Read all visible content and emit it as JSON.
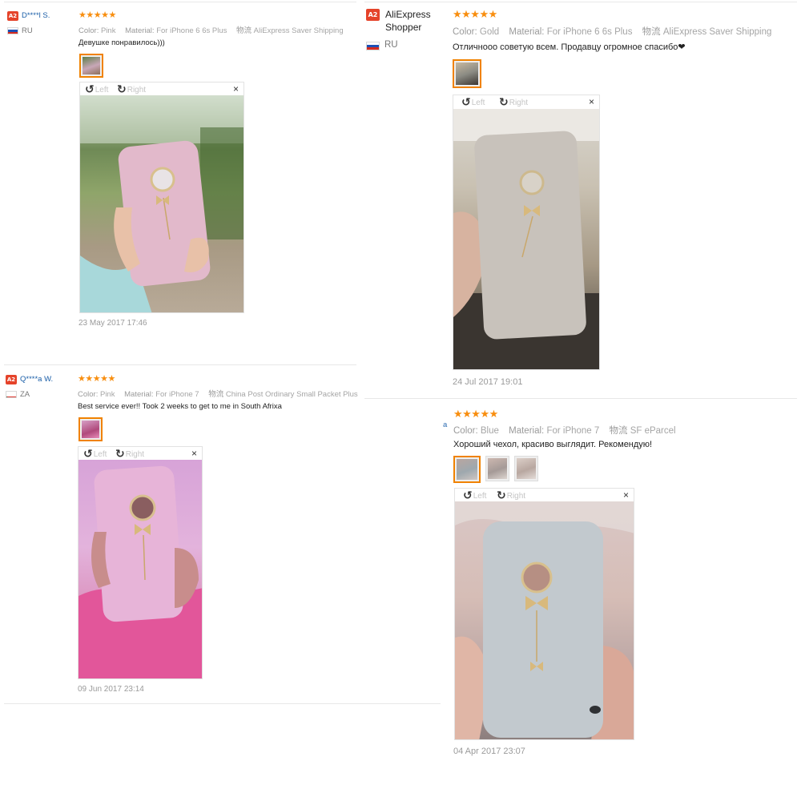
{
  "reviews": [
    {
      "user_badge": "A2",
      "user_name": "D****l S.",
      "country": "RU",
      "stars": "★★★★★",
      "attr_color_key": "Color:",
      "attr_color_val": "Pink",
      "attr_material_key": "Material:",
      "attr_material_val": "For iPhone 6 6s Plus",
      "attr_ship_key": "物流",
      "attr_ship_val": "AliExpress Saver Shipping",
      "text": "Девушке понравилось)))",
      "rotate_left": "Left",
      "rotate_right": "Right",
      "close": "×",
      "date": "23 May 2017 17:46"
    },
    {
      "user_badge": "A2",
      "user_name": "AliExpress Shopper",
      "country": "RU",
      "stars": "★★★★★",
      "attr_color_key": "Color:",
      "attr_color_val": "Gold",
      "attr_material_key": "Material:",
      "attr_material_val": "For iPhone 6 6s Plus",
      "attr_ship_key": "物流",
      "attr_ship_val": "AliExpress Saver Shipping",
      "text": "Отличнооо советую всем. Продавцу огромное спасибо❤",
      "rotate_left": "Left",
      "rotate_right": "Right",
      "close": "×",
      "date": "24 Jul 2017 19:01"
    },
    {
      "user_badge": "A2",
      "user_name": "Q****a W.",
      "country": "ZA",
      "stars": "★★★★★",
      "attr_color_key": "Color:",
      "attr_color_val": "Pink",
      "attr_material_key": "Material:",
      "attr_material_val": "For iPhone 7",
      "attr_ship_key": "物流",
      "attr_ship_val": "China Post Ordinary Small Packet Plus",
      "text": "Best service ever!! Took 2 weeks to get to me in South Afrixa",
      "rotate_left": "Left",
      "rotate_right": "Right",
      "close": "×",
      "date": "09 Jun 2017 23:14"
    },
    {
      "stars": "★★★★★",
      "attr_color_key": "Color:",
      "attr_color_val": "Blue",
      "attr_material_key": "Material:",
      "attr_material_val": "For iPhone 7",
      "attr_ship_key": "物流",
      "attr_ship_val": "SF eParcel",
      "text": "Хороший чехол, красиво выглядит. Рекомендую!",
      "rotate_left": "Left",
      "rotate_right": "Right",
      "close": "×",
      "date": "04 Apr 2017 23:07",
      "edge_fragment": "a"
    }
  ],
  "colors": {
    "star": "#f88e0f",
    "badge": "#e5432a",
    "username_link": "#1a5ea8",
    "selected_thumb": "#f08200",
    "meta_text": "#9a9a9a"
  },
  "photos": {
    "review1": "hand holding pink glitter phone case outdoors",
    "review2": "hand holding gold glitter phone case indoors",
    "review3": "hand holding pink glitter phone case over pink towel",
    "review4": "hand holding blue-silver glitter phone case"
  }
}
